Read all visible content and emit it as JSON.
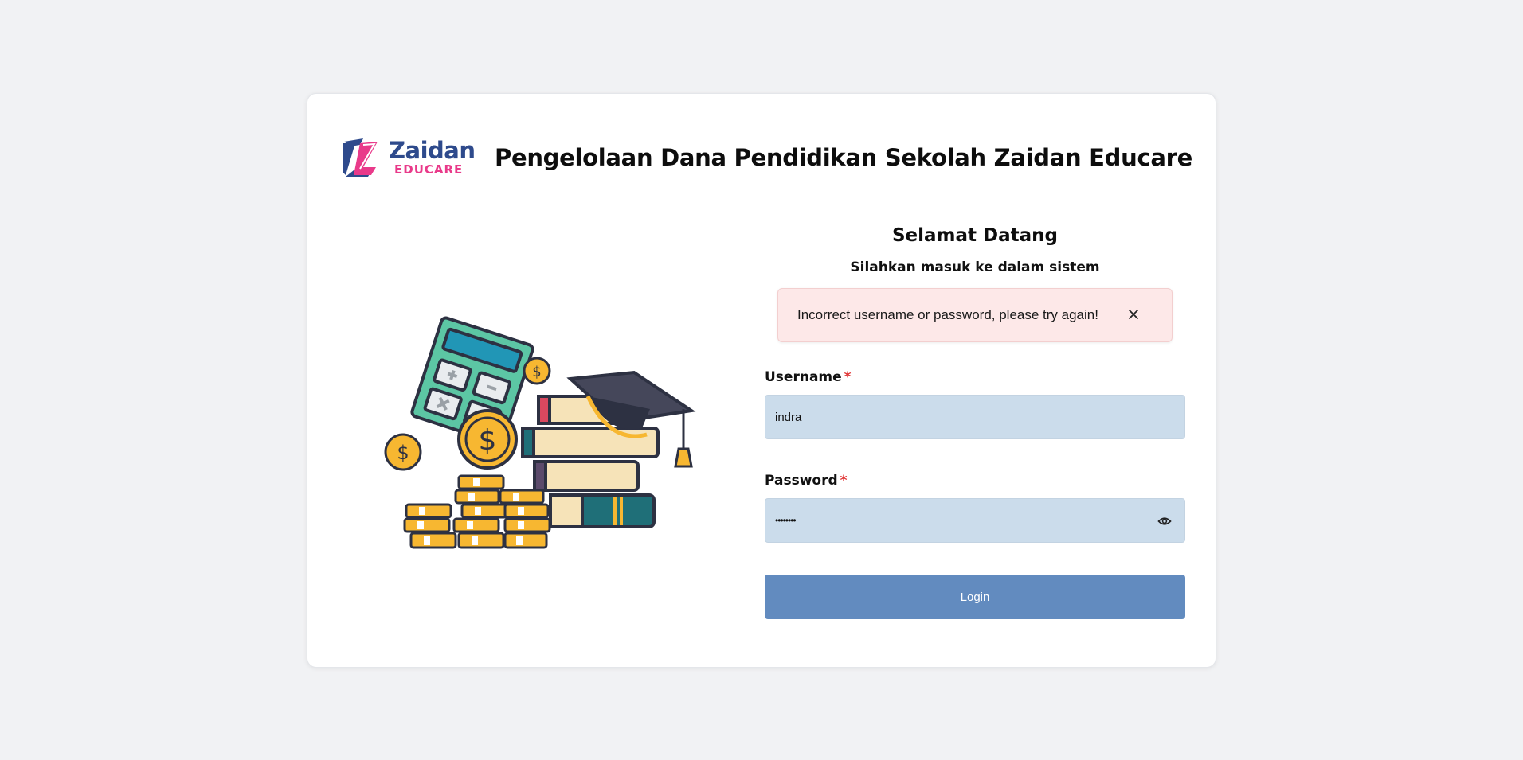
{
  "brand": {
    "name": "Zaidan",
    "sub": "EDUCARE",
    "logo_icon": "zaidan-z-logo",
    "primary_color": "#2e4a8c",
    "accent_color": "#e93a8a"
  },
  "header": {
    "title": "Pengelolaan Dana Pendidikan Sekolah Zaidan Educare"
  },
  "illustration": {
    "icon": "education-finance-illustration"
  },
  "login": {
    "welcome": "Selamat Datang",
    "subtitle": "Silahkan masuk ke dalam sistem",
    "alert": {
      "message": "Incorrect username or password, please try again!",
      "close_icon": "close-icon",
      "background": "#fde8e8"
    },
    "username": {
      "label": "Username",
      "required_mark": "*",
      "value": "indra"
    },
    "password": {
      "label": "Password",
      "required_mark": "*",
      "value": "••••••••",
      "toggle_icon": "eye-icon"
    },
    "submit_label": "Login",
    "submit_color": "#628bbf",
    "input_background": "#cbdceb"
  }
}
